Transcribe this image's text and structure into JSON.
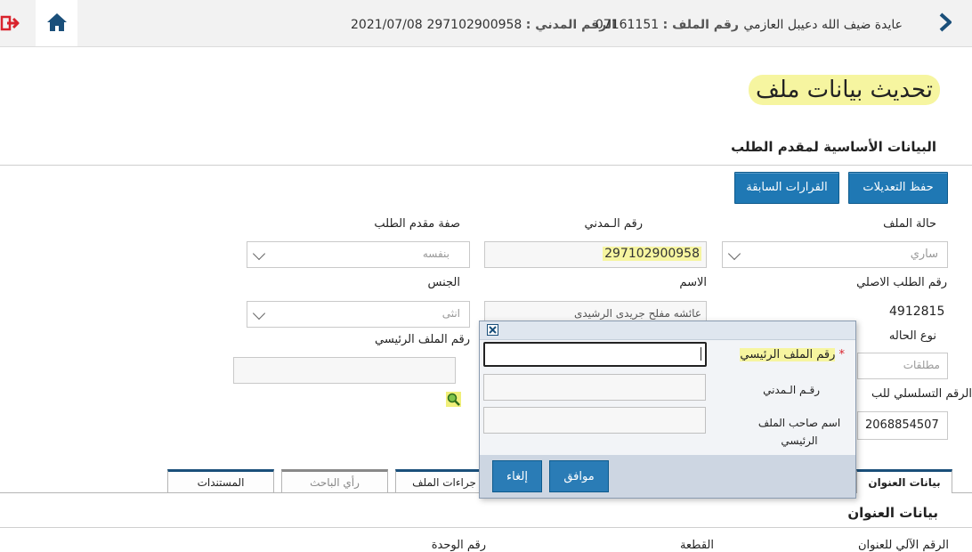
{
  "header": {
    "user_name": "عايدة ضيف الله دعيبل العازمي",
    "file_number_label": "رقم الملف :",
    "file_number_value": "07161151",
    "civil_id_label": "الرقم المدني :",
    "civil_id_value": "297102900958",
    "date": "2021/07/08"
  },
  "page": {
    "title": "تحديث بيانات ملف",
    "section_title": "البيانات الأساسية لمقدم الطلب"
  },
  "buttons": {
    "save": "حفظ التعديلات",
    "previous_decisions": "القرارات السابقة"
  },
  "form": {
    "file_status_label": "حالة الملف",
    "file_status_value": "ساري",
    "civil_id_label": "رقم الـمدني",
    "civil_id_value": "297102900958",
    "applicant_role_label": "صفة مقدم الطلب",
    "applicant_role_value": "بنفسه",
    "original_request_label": "رقم الطلب الاصلي",
    "original_request_value": "4912815",
    "name_label": "الاسم",
    "name_value": "عائشه مفلح جريدى الرشيدى",
    "gender_label": "الجنس",
    "gender_value": "انثى",
    "case_type_label": "نوع الحاله",
    "case_type_value": "مطلقات",
    "main_file_label": "رقم الملف الرئيسي",
    "serial_label": "الرقم التسلسلي للب",
    "serial_value": "2068854507"
  },
  "dialog": {
    "main_file_label": "رقم الملف الرئيسي",
    "required_mark": "*",
    "civil_id_label": "رقـم الـمدني",
    "owner_name_label": "اسم صاحب الملف الرئيسي",
    "ok": "موافق",
    "cancel": "إلغاء"
  },
  "tabs": [
    {
      "label": "بيانات العنوان",
      "state": "active"
    },
    {
      "label": "جراءات الملف",
      "state": "normal"
    },
    {
      "label": "رأي الباحث",
      "state": "disabled"
    },
    {
      "label": "المستندات",
      "state": "normal"
    }
  ],
  "address": {
    "title": "بيانات العنوان",
    "auto_number_label": "الرقم الآلي للعنوان",
    "block_label": "القطعة",
    "unit_label": "رقم الوحدة"
  },
  "colors": {
    "accent": "#1f78b4",
    "highlight": "#f6f5a0",
    "exit": "#d9232d",
    "home": "#1a4f7a"
  }
}
